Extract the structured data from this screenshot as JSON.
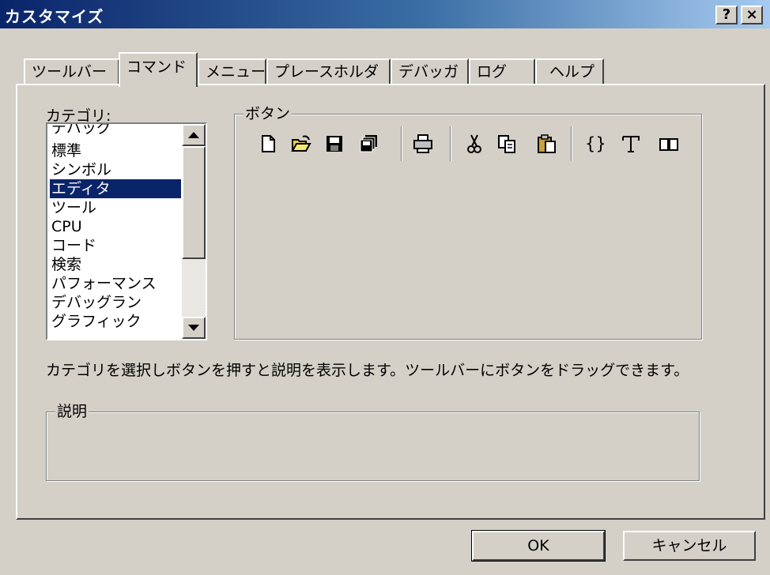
{
  "window": {
    "title": "カスタマイズ",
    "help_label": "?",
    "close_label": "×"
  },
  "tabs": [
    {
      "label": "ツールバー"
    },
    {
      "label": "コマンド"
    },
    {
      "label": "メニュー"
    },
    {
      "label": "プレースホルダ"
    },
    {
      "label": "デバッガ"
    },
    {
      "label": "ログ"
    },
    {
      "label": "ヘルプ"
    }
  ],
  "active_tab": "コマンド",
  "categories": {
    "label": "カテゴリ:",
    "items": [
      {
        "label": "デバッグ"
      },
      {
        "label": "標準"
      },
      {
        "label": "シンボル"
      },
      {
        "label": "エディタ"
      },
      {
        "label": "ツール"
      },
      {
        "label": "CPU"
      },
      {
        "label": "コード"
      },
      {
        "label": "検索"
      },
      {
        "label": "パフォーマンス"
      },
      {
        "label": "デバッグラン"
      },
      {
        "label": "グラフィック"
      }
    ],
    "selected": "エディタ"
  },
  "buttons_group": {
    "title": "ボタン",
    "icons": [
      "new-file-icon",
      "open-folder-icon",
      "save-icon",
      "save-all-icon",
      "print-icon",
      "cut-icon",
      "copy-icon",
      "paste-icon",
      "braces-icon",
      "text-format-icon",
      "book-icon"
    ],
    "braces_glyph": "{}"
  },
  "hint": "カテゴリを選択しボタンを押すと説明を表示します。ツールバーにボタンをドラッグできます。",
  "description_group": {
    "title": "説明"
  },
  "footer": {
    "ok_label": "OK",
    "cancel_label": "キャンセル"
  }
}
